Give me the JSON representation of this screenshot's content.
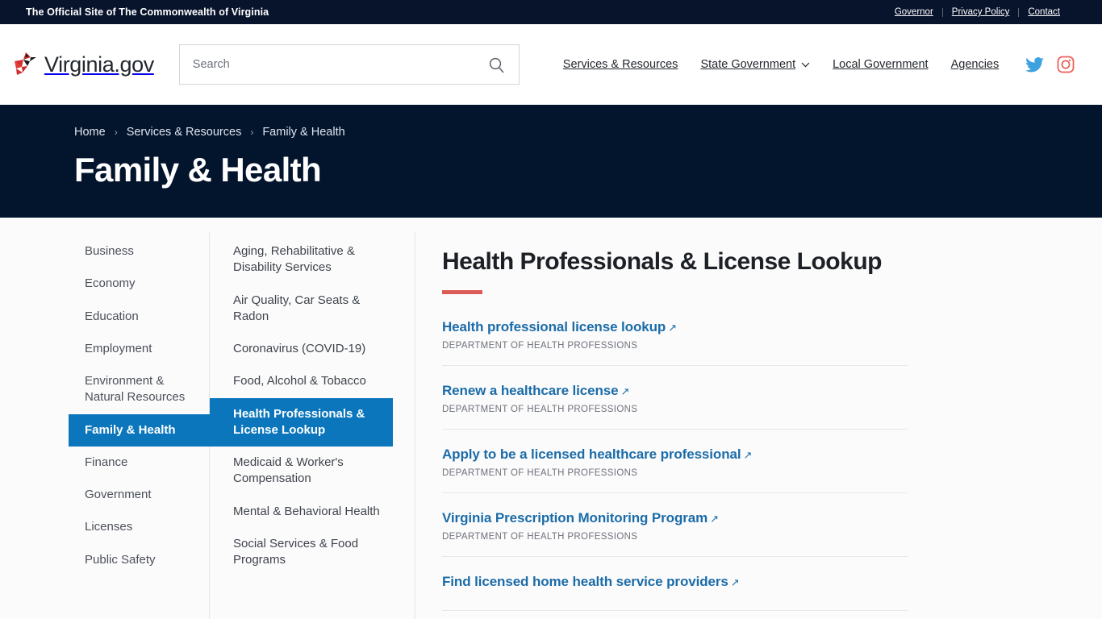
{
  "utility": {
    "tagline": "The Official Site of The Commonwealth of Virginia",
    "links": [
      {
        "label": "Governor"
      },
      {
        "label": "Privacy Policy"
      },
      {
        "label": "Contact"
      }
    ]
  },
  "masthead": {
    "brand_word": "Virginia.gov",
    "logo_icon": "cardinal-bird-icon",
    "search": {
      "placeholder": "Search",
      "value": "",
      "icon": "search-icon"
    },
    "nav": [
      {
        "label": "Services & Resources",
        "has_caret": false
      },
      {
        "label": "State Government",
        "has_caret": true
      },
      {
        "label": "Local Government",
        "has_caret": false
      },
      {
        "label": "Agencies",
        "has_caret": false
      }
    ],
    "social": [
      {
        "name": "twitter-icon",
        "color": "#3fa2e0"
      },
      {
        "name": "instagram-icon",
        "color": "#e8605a"
      }
    ]
  },
  "hero": {
    "breadcrumb": [
      "Home",
      "Services & Resources",
      "Family & Health"
    ],
    "separator": "›",
    "title": "Family & Health",
    "background": "#03142d"
  },
  "sidebar_primary": {
    "active": "Family & Health",
    "items": [
      {
        "label": "Business"
      },
      {
        "label": "Economy"
      },
      {
        "label": "Education"
      },
      {
        "label": "Employment"
      },
      {
        "label": "Environment & Natural Resources"
      },
      {
        "label": "Family & Health"
      },
      {
        "label": "Finance"
      },
      {
        "label": "Government"
      },
      {
        "label": "Licenses"
      },
      {
        "label": "Public Safety"
      }
    ]
  },
  "sidebar_secondary": {
    "active": "Health Professionals & License Lookup",
    "items": [
      {
        "label": "Aging, Rehabilitative & Disability Services"
      },
      {
        "label": "Air Quality, Car Seats & Radon"
      },
      {
        "label": "Coronavirus (COVID-19)"
      },
      {
        "label": "Food, Alcohol & Tobacco"
      },
      {
        "label": "Health Professionals & License Lookup"
      },
      {
        "label": "Medicaid & Worker's Compensation"
      },
      {
        "label": "Mental & Behavioral Health"
      },
      {
        "label": "Social Services & Food Programs"
      }
    ]
  },
  "main": {
    "title": "Health Professionals & License Lookup",
    "accent_color": "#dd5b56",
    "link_color": "#1b6ca8",
    "external_arrow": "↗",
    "resources": [
      {
        "label": "Health professional license lookup",
        "agency": "DEPARTMENT OF HEALTH PROFESSIONS"
      },
      {
        "label": "Renew a healthcare license",
        "agency": "DEPARTMENT OF HEALTH PROFESSIONS"
      },
      {
        "label": "Apply to be a licensed healthcare professional",
        "agency": "DEPARTMENT OF HEALTH PROFESSIONS"
      },
      {
        "label": "Virginia Prescription Monitoring Program",
        "agency": "DEPARTMENT OF HEALTH PROFESSIONS"
      },
      {
        "label": "Find licensed home health service providers",
        "agency": ""
      }
    ]
  }
}
